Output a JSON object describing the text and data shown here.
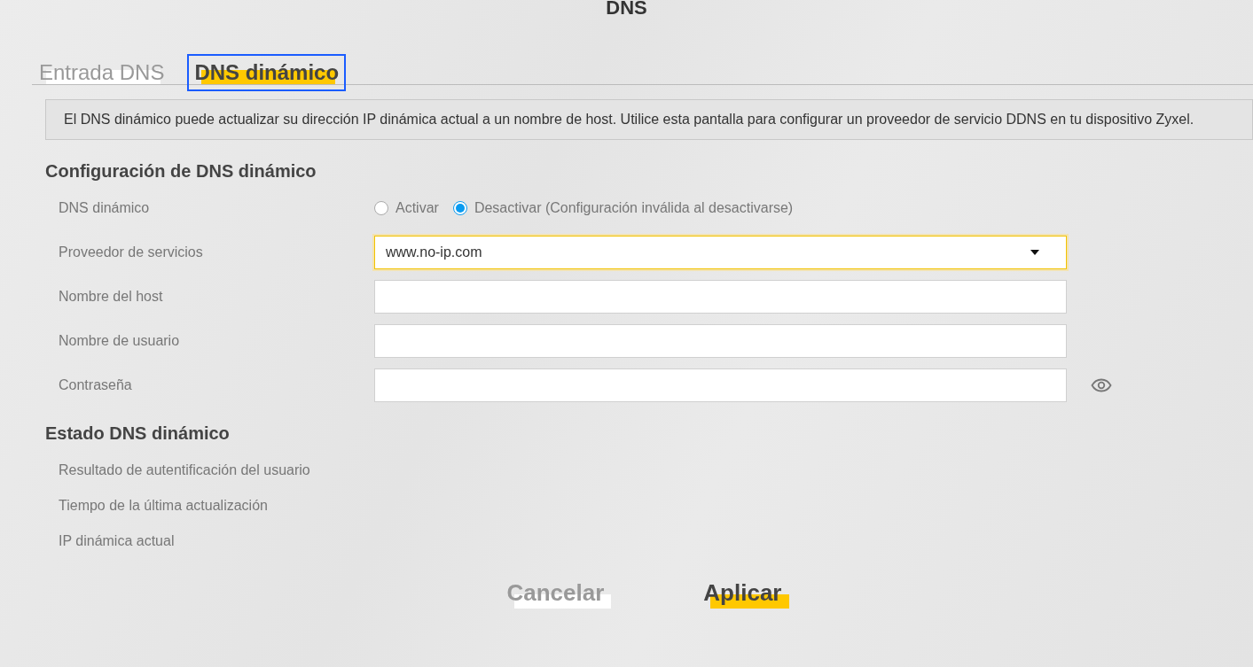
{
  "title": "DNS",
  "tabs": [
    {
      "label": "Entrada DNS",
      "selected": false
    },
    {
      "label": "DNS dinámico",
      "selected": true
    }
  ],
  "info": "El DNS dinámico puede actualizar su dirección IP dinámica actual a un nombre de host. Utilice esta pantalla para configurar un proveedor de servicio DDNS en tu dispositivo Zyxel.",
  "config": {
    "heading": "Configuración de DNS dinámico",
    "rows": [
      {
        "kind": "radio",
        "label": "DNS dinámico",
        "options": [
          {
            "label": "Activar",
            "selected": false
          },
          {
            "label": "Desactivar (Configuración inválida al desactivarse)",
            "selected": true
          }
        ]
      },
      {
        "kind": "select",
        "label": "Proveedor de servicios",
        "value": "www.no-ip.com",
        "focused": true
      },
      {
        "kind": "text",
        "label": "Nombre del host",
        "focused": false
      },
      {
        "kind": "text",
        "label": "Nombre de usuario",
        "focused": false
      },
      {
        "kind": "password",
        "label": "Contraseña",
        "focused": false
      }
    ]
  },
  "status": {
    "heading": "Estado DNS dinámico",
    "rows": [
      "Resultado de autentificación del usuario",
      "Tiempo de la última actualización",
      "IP dinámica actual"
    ]
  },
  "buttons": [
    {
      "label": "Cancelar",
      "kind": "secondary"
    },
    {
      "label": "Aplicar",
      "kind": "primary"
    }
  ]
}
